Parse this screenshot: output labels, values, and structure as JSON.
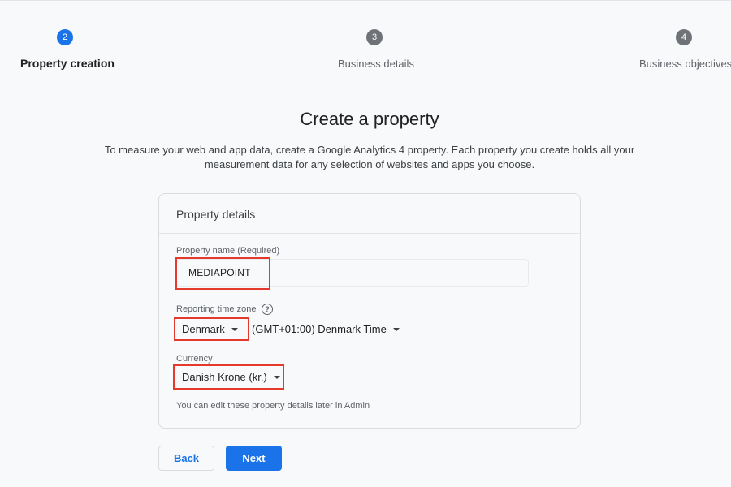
{
  "stepper": {
    "steps": [
      {
        "number": "2",
        "label": "Property creation",
        "state": "active"
      },
      {
        "number": "3",
        "label": "Business details",
        "state": "inactive"
      },
      {
        "number": "4",
        "label": "Business objectives",
        "state": "inactive"
      }
    ]
  },
  "page": {
    "title": "Create a property",
    "description": "To measure your web and app data, create a Google Analytics 4 property. Each property you create holds all your measurement data for any selection of websites and apps you choose."
  },
  "card": {
    "title": "Property details",
    "property_name": {
      "label": "Property name (Required)",
      "value": "MEDIAPOINT"
    },
    "time_zone": {
      "label": "Reporting time zone",
      "help_icon": "question-circle-icon",
      "country": "Denmark",
      "zone": "(GMT+01:00) Denmark Time"
    },
    "currency": {
      "label": "Currency",
      "value": "Danish Krone (kr.)"
    },
    "note": "You can edit these property details later in Admin"
  },
  "buttons": {
    "back": "Back",
    "next": "Next"
  },
  "colors": {
    "accent": "#1a73e8",
    "highlight": "#e4392b",
    "background": "#f8f9fa"
  }
}
